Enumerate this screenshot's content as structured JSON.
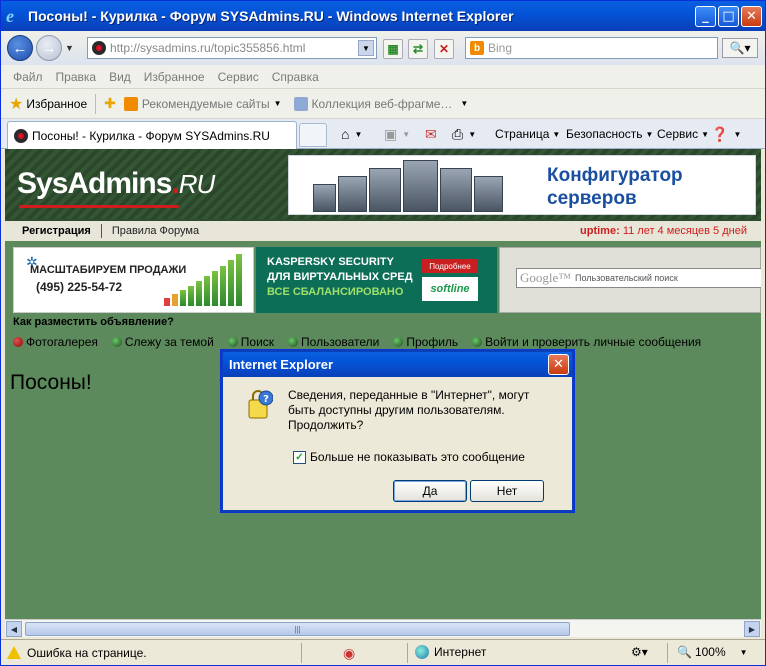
{
  "window": {
    "title": "Посоны! - Курилка - Форум SYSAdmins.RU - Windows Internet Explorer"
  },
  "address": {
    "url_prefix": "http://sysadmins.ru",
    "url_path": "/topic355856.html"
  },
  "search": {
    "placeholder": "Bing"
  },
  "menubar": {
    "items": [
      "Файл",
      "Правка",
      "Вид",
      "Избранное",
      "Сервис",
      "Справка"
    ]
  },
  "favorites": {
    "label": "Избранное",
    "items": [
      "Рекомендуемые сайты",
      "Коллекция веб-фрагме…"
    ]
  },
  "tabs": {
    "active_label": "Посоны! - Курилка - Форум SYSAdmins.RU"
  },
  "commandbar": {
    "page": "Страница",
    "safety": "Безопасность",
    "tools": "Сервис"
  },
  "site": {
    "logo_main": "SysAdmins",
    "logo_ru": "RU",
    "banner_text_line1": "Конфигуратор",
    "banner_text_line2": "серверов",
    "nav_register": "Регистрация",
    "nav_rules": "Правила Форума",
    "uptime_label": "uptime:",
    "uptime_value": "11 лет 4 месяцев 5 дней",
    "ad1_line1": "МАСШТАБИРУЕМ ПРОДАЖИ",
    "ad1_line2": "(495) 225-54-72",
    "ad2_line1": "KASPERSKY SECURITY",
    "ad2_line2": "ДЛЯ ВИРТУАЛЬНЫХ СРЕД",
    "ad2_line3": "ВСЕ СБАЛАНСИРОВАНО",
    "ad2_button": "Подробнее",
    "ad2_logo": "softline",
    "google_logo": "Google™",
    "google_placeholder": "Пользовательский поиск",
    "howto": "Как разместить объявление?",
    "links": [
      "Фотогалерея",
      "Слежу за темой",
      "Поиск",
      "Пользователи",
      "Профиль",
      "Войти и проверить личные сообщения"
    ],
    "heading": "Посоны!"
  },
  "dialog": {
    "title": "Internet Explorer",
    "message": "Сведения, переданные в \"Интернет\", могут быть доступны другим пользователям. Продолжить?",
    "checkbox_label": "Больше не показывать это сообщение",
    "checkbox_checked": true,
    "yes_label": "Да",
    "no_label": "Нет"
  },
  "statusbar": {
    "text": "Ошибка на странице.",
    "zone": "Интернет",
    "zoom": "100%"
  }
}
